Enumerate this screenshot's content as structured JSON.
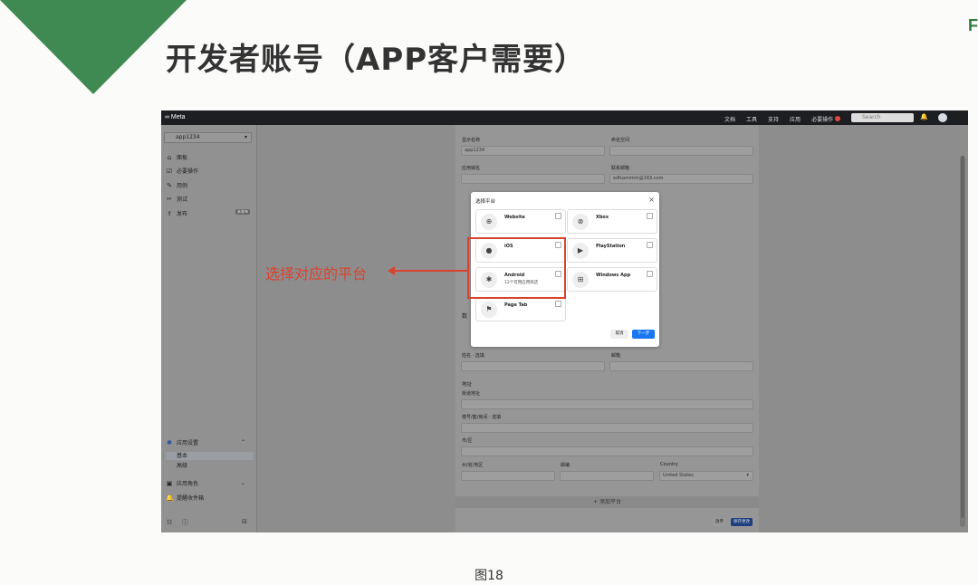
{
  "slide": {
    "title": "开发者账号（APP客户需要）",
    "caption": "图18",
    "corner_letter": "F"
  },
  "annotation": {
    "text": "选择对应的平台",
    "color": "#d8432f"
  },
  "topbar": {
    "logo": "∞ Meta",
    "nav": [
      "文档",
      "工具",
      "支持",
      "应用",
      "必要操作"
    ],
    "search_placeholder": "Search"
  },
  "sidebar": {
    "app_name": "app1234",
    "items": [
      {
        "icon": "home-icon",
        "label": "面板"
      },
      {
        "icon": "checklist-icon",
        "label": "必要操作"
      },
      {
        "icon": "pencil-icon",
        "label": "用例"
      },
      {
        "icon": "test-icon",
        "label": "测试"
      },
      {
        "icon": "upload-icon",
        "label": "发布"
      }
    ],
    "publish_tag": "未发布",
    "settings_label": "应用设置",
    "settings_sub": [
      "基本",
      "高级"
    ],
    "roles_label": "应用角色",
    "alerts_label": "提醒收件箱"
  },
  "form": {
    "display_name_label": "显示名称",
    "display_name_value": "app1234",
    "namespace_label": "命名空间",
    "app_domain_label": "应用域名",
    "contact_email_label": "联系邮箱",
    "contact_email_value": "xdfuxmmm@163.com",
    "data_section_label": "数",
    "name_label": "姓名 · 选填",
    "email_label": "邮箱",
    "address_section": "地址",
    "street_label": "街道地址",
    "apt_label": "楼号/套/房间 · 选填",
    "city_label": "市/区",
    "state_label": "州/省/地区",
    "zip_label": "邮编",
    "country_label": "Country",
    "country_value": "United States",
    "add_platform": "+ 添加平台",
    "discard": "放弃",
    "save": "保存更改"
  },
  "modal": {
    "title": "选择平台",
    "platforms": [
      {
        "name": "Website",
        "sub": "",
        "icon": "globe-icon"
      },
      {
        "name": "Xbox",
        "sub": "",
        "icon": "xbox-icon"
      },
      {
        "name": "iOS",
        "sub": "",
        "icon": "apple-icon"
      },
      {
        "name": "PlayStation",
        "sub": "",
        "icon": "playstation-icon"
      },
      {
        "name": "Android",
        "sub": "12个可用应用商店",
        "icon": "android-icon"
      },
      {
        "name": "Windows App",
        "sub": "",
        "icon": "windows-icon"
      },
      {
        "name": "Page Tab",
        "sub": "",
        "icon": "flag-icon"
      }
    ],
    "cancel": "取消",
    "next": "下一步"
  }
}
